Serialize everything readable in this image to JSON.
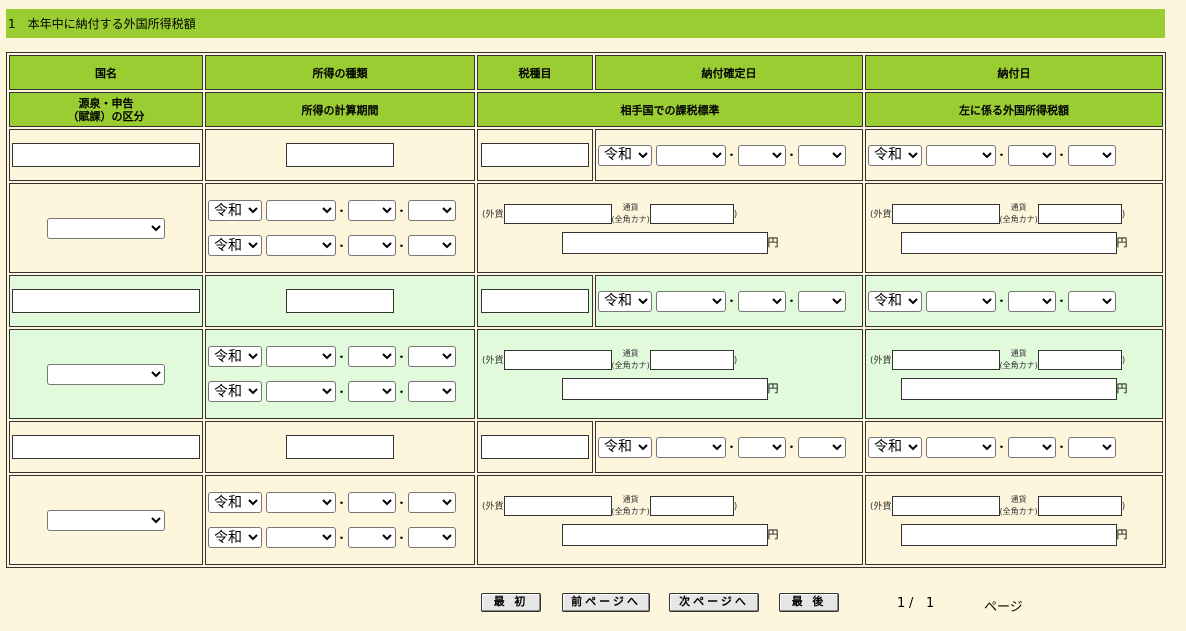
{
  "section": {
    "title": "1　本年中に納付する外国所得税額"
  },
  "headers": {
    "row1": [
      "国名",
      "所得の種類",
      "税種目",
      "納付確定日",
      "納付日"
    ],
    "row2_col1_line1": "源泉・申告",
    "row2_col1_line2": "（賦課）の区分",
    "row2": [
      "所得の計算期間",
      "相手国での課税標準",
      "左に係る外国所得税額"
    ]
  },
  "era_label": "令和",
  "date_separator": "・",
  "currency": {
    "foreign_label": "(外貨",
    "tsuka_line1": "通貨",
    "tsuka_line2": "(全角カナ)",
    "close_paren": ")",
    "yen": "円"
  },
  "nav": {
    "first": "最 初",
    "prev": "前ページへ",
    "next": "次ページへ",
    "last": "最 後",
    "page_current": "1",
    "page_sep": "/",
    "page_total": "1",
    "page_suffix": "ページ"
  }
}
